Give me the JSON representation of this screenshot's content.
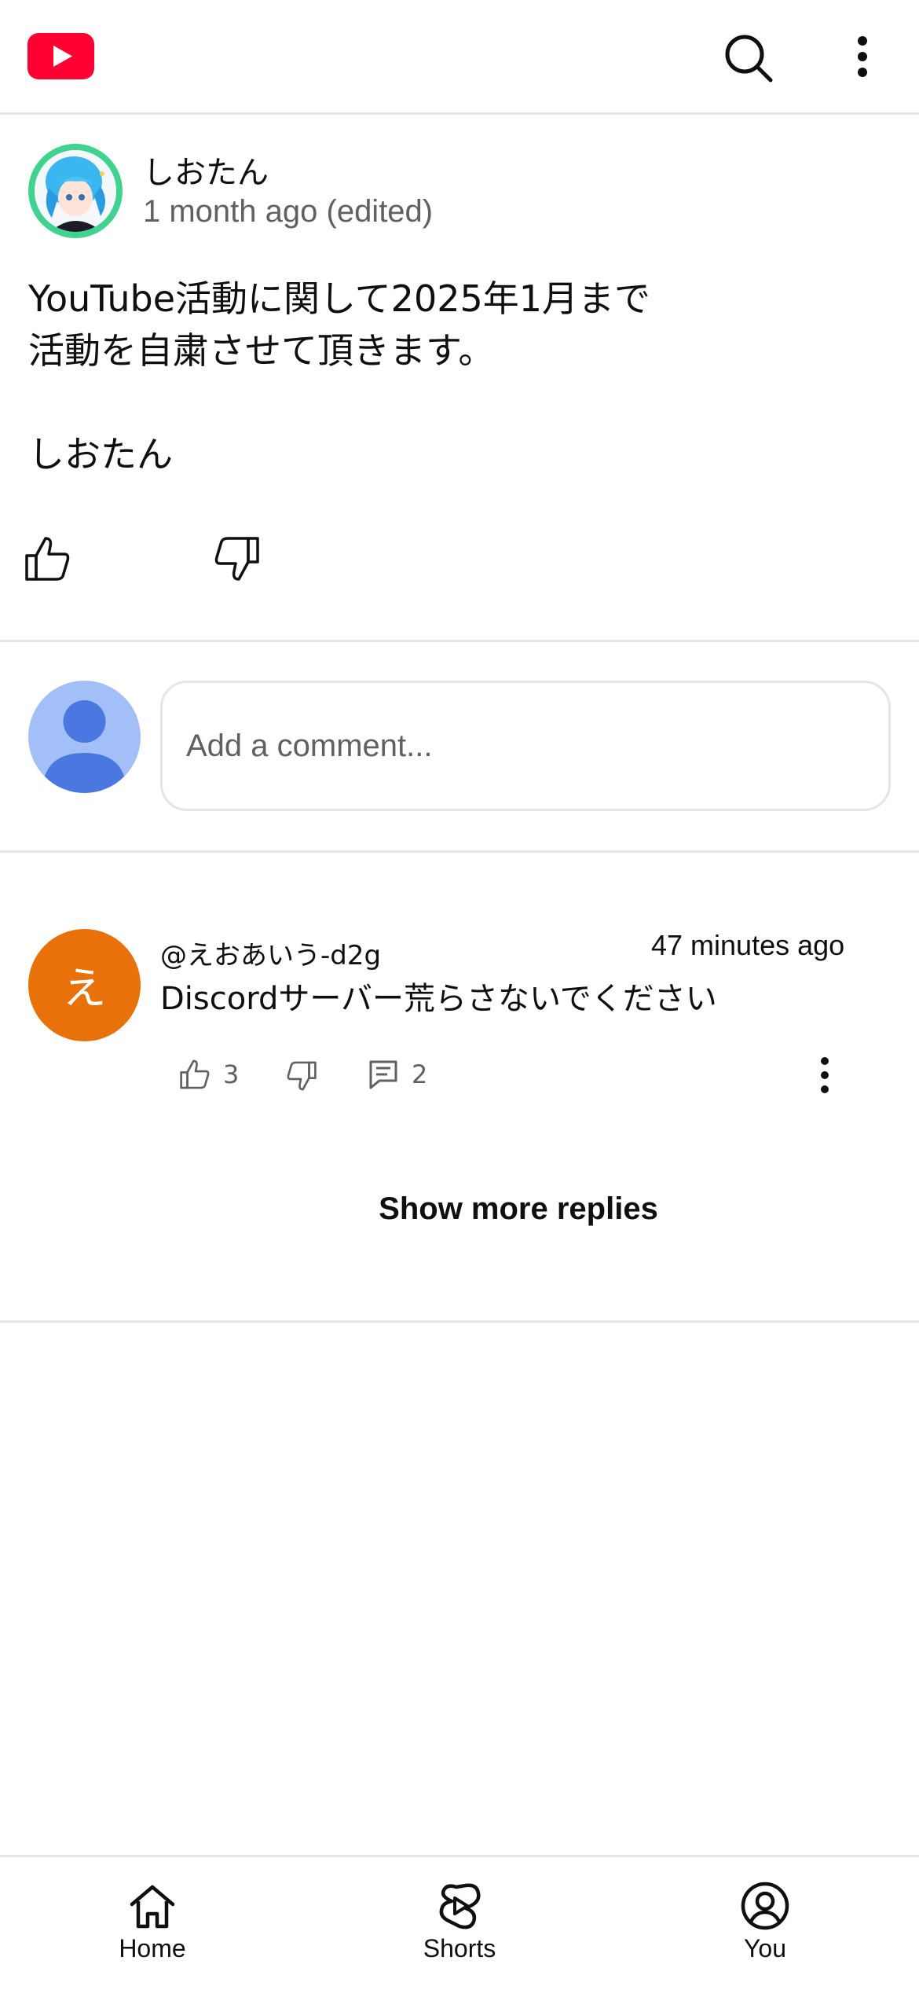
{
  "header": {
    "logo_icon": "youtube-logo-icon",
    "brand_color": "#ff0033",
    "search_icon": "search-icon",
    "more_icon": "more-vertical-icon"
  },
  "post": {
    "channel_name": "しおたん",
    "time": "1 month ago (edited)",
    "body": "YouTube活動に関して2025年1月まで\n活動を自粛させて頂きます。\n\nしおたん",
    "like_icon": "thumbs-up-icon",
    "dislike_icon": "thumbs-down-icon"
  },
  "compose": {
    "placeholder": "Add a comment...",
    "avatar_icon": "default-user-avatar-icon"
  },
  "comments": [
    {
      "avatar_letter": "え",
      "avatar_color": "#e8710a",
      "author": "@えおあいう-d2g",
      "time": "47 minutes ago",
      "text": "Discordサーバー荒らさないでください",
      "likes": "3",
      "replies": "2"
    }
  ],
  "show_more_label": "Show more replies",
  "nav": {
    "items": [
      {
        "label": "Home",
        "icon": "home-icon"
      },
      {
        "label": "Shorts",
        "icon": "shorts-icon"
      },
      {
        "label": "You",
        "icon": "account-circle-icon"
      }
    ]
  }
}
